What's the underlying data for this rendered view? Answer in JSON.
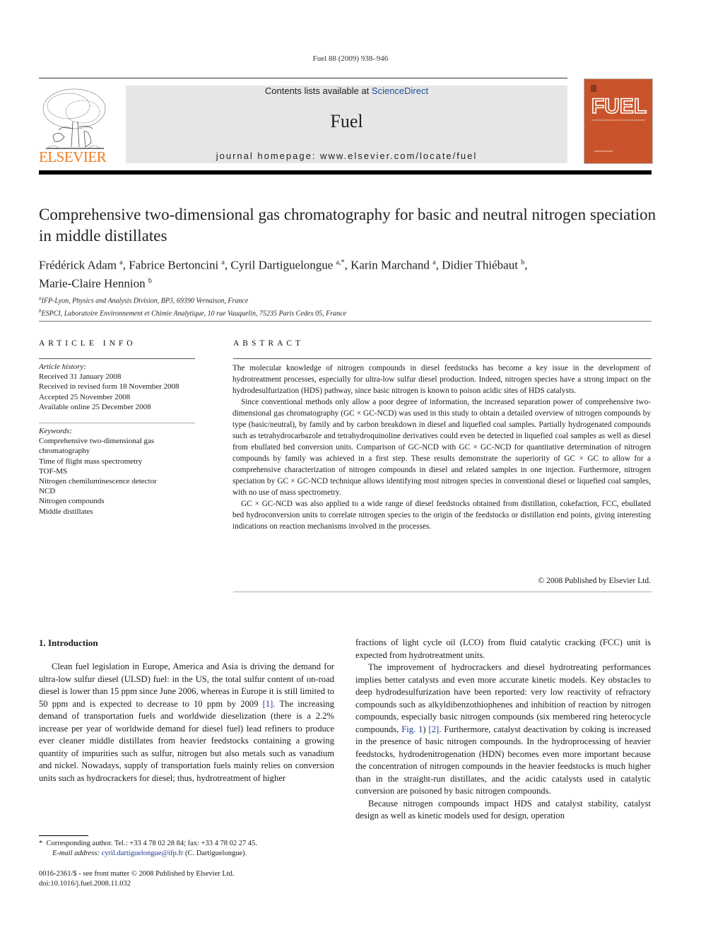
{
  "running_head": "Fuel 88 (2009) 938–946",
  "header": {
    "publisher_logo_text": "ELSEVIER",
    "contents_prefix": "Contents lists available at ",
    "contents_link": "ScienceDirect",
    "journal_name": "Fuel",
    "homepage": "journal homepage: www.elsevier.com/locate/fuel",
    "cover_title": "FUEL",
    "cover_subtitle": "the science and technology of fuel and energy",
    "colors": {
      "publisher_orange": "#f07c1d",
      "cover_orange": "#c9542b",
      "link_blue": "#1f4e9a",
      "banner_gray": "#e6e6e6"
    }
  },
  "article": {
    "title": "Comprehensive two-dimensional gas chromatography for basic and neutral nitrogen speciation in middle distillates",
    "authors": [
      {
        "name": "Frédérick Adam",
        "sup": "a",
        "sep": ", "
      },
      {
        "name": "Fabrice Bertoncini",
        "sup": "a",
        "sep": ", "
      },
      {
        "name": "Cyril Dartiguelongue",
        "sup": "a,*",
        "sep": ", "
      },
      {
        "name": "Karin Marchand",
        "sup": "a",
        "sep": ", "
      },
      {
        "name": "Didier Thiébaut",
        "sup": "b",
        "sep": ","
      },
      {
        "name": "Marie-Claire Hennion",
        "sup": "b",
        "sep": ""
      }
    ],
    "affiliations": [
      {
        "key": "a",
        "text": "IFP-Lyon, Physics and Analysis Division, BP3, 69390 Vernaison, France"
      },
      {
        "key": "b",
        "text": "ESPCI, Laboratoire Environnement et Chimie Analytique, 10 rue Vauquelin, 75235 Paris Cedex 05, France"
      }
    ]
  },
  "article_info": {
    "heading": "ARTICLE INFO",
    "history_label": "Article history:",
    "history": [
      "Received 31 January 2008",
      "Received in revised form 18 November 2008",
      "Accepted 25 November 2008",
      "Available online 25 December 2008"
    ],
    "keywords_label": "Keywords:",
    "keywords": [
      "Comprehensive two-dimensional gas chromatography",
      "Time of flight mass spectrometry",
      "TOF-MS",
      "Nitrogen chemiluminescence detector",
      "NCD",
      "Nitrogen compounds",
      "Middle distillates"
    ]
  },
  "abstract": {
    "heading": "ABSTRACT",
    "paragraphs": [
      "The molecular knowledge of nitrogen compounds in diesel feedstocks has become a key issue in the development of hydrotreatment processes, especially for ultra-low sulfur diesel production. Indeed, nitrogen species have a strong impact on the hydrodesulfurization (HDS) pathway, since basic nitrogen is known to poison acidic sites of HDS catalysts.",
      "Since conventional methods only allow a poor degree of information, the increased separation power of comprehensive two-dimensional gas chromatography (GC × GC-NCD) was used in this study to obtain a detailed overview of nitrogen compounds by type (basic/neutral), by family and by carbon breakdown in diesel and liquefied coal samples. Partially hydrogenated compounds such as tetrahydrocarbazole and tetrahydroquinoline derivatives could even be detected in liquefied coal samples as well as diesel from ebullated bed conversion units. Comparison of GC-NCD with GC × GC-NCD for quantitative determination of nitrogen compounds by family was achieved in a first step. These results demonstrate the superiority of GC × GC to allow for a comprehensive characterization of nitrogen compounds in diesel and related samples in one injection. Furthermore, nitrogen speciation by GC × GC-NCD technique allows identifying most nitrogen species in conventional diesel or liquefied coal samples, with no use of mass spectrometry.",
      "GC × GC-NCD was also applied to a wide range of diesel feedstocks obtained from distillation, cokefaction, FCC, ebullated bed hydroconversion units to correlate nitrogen species to the origin of the feedstocks or distillation end points, giving interesting indications on reaction mechanisms involved in the processes."
    ],
    "copyright": "© 2008 Published by Elsevier Ltd."
  },
  "body": {
    "section_heading": "1. Introduction",
    "left_column": [
      {
        "parts": [
          {
            "t": "Clean fuel legislation in Europe, America and Asia is driving the demand for ultra-low sulfur diesel (ULSD) fuel: in the US, the total sulfur content of on-road diesel is lower than 15 ppm since June 2006, whereas in Europe it is still limited to 50 ppm and is expected to decrease to 10 ppm by 2009 "
          },
          {
            "t": "[1]",
            "cite": true
          },
          {
            "t": ". The increasing demand of transportation fuels and worldwide dieselization (there is a 2.2% increase per year of worldwide demand for diesel fuel) lead refiners to produce ever cleaner middle distillates from heavier feedstocks containing a growing quantity of impurities such as sulfur, nitrogen but also metals such as vanadium and nickel. Nowadays, supply of transportation fuels mainly relies on conversion units such as hydrocrackers for diesel; thus, hydrotreatment of higher"
          }
        ]
      }
    ],
    "right_column": [
      {
        "noindent": true,
        "parts": [
          {
            "t": "fractions of light cycle oil (LCO) from fluid catalytic cracking (FCC) unit is expected from hydrotreatment units."
          }
        ]
      },
      {
        "parts": [
          {
            "t": "The improvement of hydrocrackers and diesel hydrotreating performances implies better catalysts and even more accurate kinetic models. Key obstacles to deep hydrodesulfurization have been reported: very low reactivity of refractory compounds such as alkyldibenzothiophenes and inhibition of reaction by nitrogen compounds, especially basic nitrogen compounds (six membered ring heterocycle compounds, "
          },
          {
            "t": "Fig. 1",
            "cite": true
          },
          {
            "t": ") "
          },
          {
            "t": "[2]",
            "cite": true
          },
          {
            "t": ". Furthermore, catalyst deactivation by coking is increased in the presence of basic nitrogen compounds. In the hydroprocessing of heavier feedstocks, hydrodenitrogenation (HDN) becomes even more important because the concentration of nitrogen compounds in the heavier feedstocks is much higher than in the straight-run distillates, and the acidic catalysts used in catalytic conversion are poisoned by basic nitrogen compounds."
          }
        ]
      },
      {
        "parts": [
          {
            "t": "Because nitrogen compounds impact HDS and catalyst stability, catalyst design as well as kinetic models used for design, operation"
          }
        ]
      }
    ]
  },
  "footnote": {
    "marker": "*",
    "corresponding": "Corresponding author. Tel.: +33 4 78 02 28 84; fax: +33 4 78 02 27 45.",
    "email_label": "E-mail address:",
    "email": "cyril.dartiguelongue@ifp.fr",
    "email_suffix": " (C. Dartiguelongue)."
  },
  "front_matter": {
    "issn_line": "0016-2361/$ - see front matter © 2008 Published by Elsevier Ltd.",
    "doi": "doi:10.1016/j.fuel.2008.11.032"
  }
}
